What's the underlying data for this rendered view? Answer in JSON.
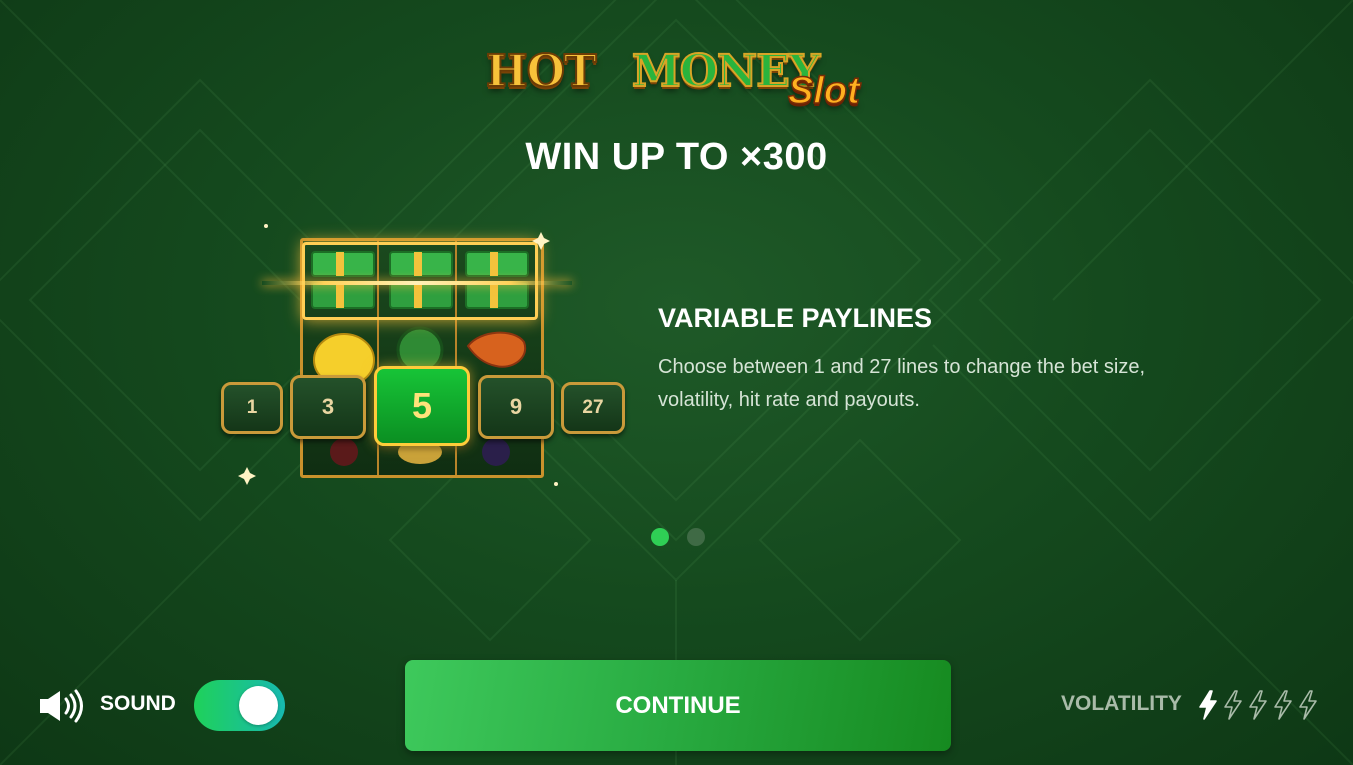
{
  "logo": {
    "part1": "HOT",
    "part2": "MONEY",
    "part3": "Slot"
  },
  "headline": "WIN UP TO ×300",
  "lines": [
    {
      "label": "1",
      "active": false
    },
    {
      "label": "3",
      "active": false
    },
    {
      "label": "5",
      "active": true
    },
    {
      "label": "9",
      "active": false
    },
    {
      "label": "27",
      "active": false
    }
  ],
  "feature": {
    "title": "VARIABLE PAYLINES",
    "description": "Choose between 1 and 27 lines to change the bet size, volatility, hit rate and payouts."
  },
  "pagination": {
    "total": 2,
    "current": 1,
    "active_color": "#2fcf55",
    "inactive_color": "#3f6a45"
  },
  "sound": {
    "label": "SOUND",
    "enabled": true,
    "icon": "speaker-on-icon"
  },
  "continue_label": "CONTINUE",
  "volatility": {
    "label": "VOLATILITY",
    "level": 1,
    "max": 5,
    "icon": "lightning-icon"
  },
  "colors": {
    "accent": "#2aad43",
    "gold": "#c99a3a",
    "background": "#154a1e"
  }
}
